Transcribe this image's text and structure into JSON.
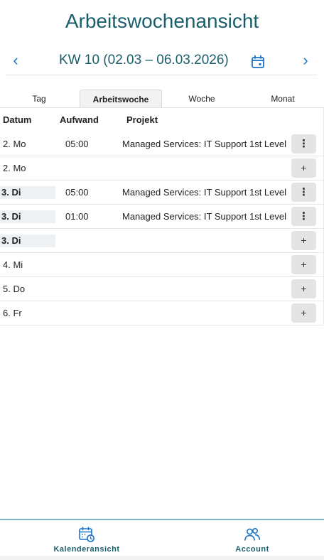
{
  "header": {
    "title": "Arbeitswochenansicht"
  },
  "week_nav": {
    "prev_symbol": "‹",
    "next_symbol": "›",
    "label": "KW 10 (02.03 – 06.03.2026)",
    "calendar_icon": "calendar-icon"
  },
  "tabs": [
    {
      "label": "Tag",
      "active": false
    },
    {
      "label": "Arbeitswoche",
      "active": true
    },
    {
      "label": "Woche",
      "active": false
    },
    {
      "label": "Monat",
      "active": false
    }
  ],
  "table": {
    "headers": {
      "date": "Datum",
      "effort": "Aufwand",
      "project": "Projekt"
    },
    "rows": [
      {
        "date": "2. Mo",
        "time": "05:00",
        "project": "Managed Services: IT Support 1st Level",
        "action": "⋮"
      },
      {
        "date": "2. Mo",
        "time": "",
        "project": "",
        "action": "+"
      },
      {
        "date": "3. Di",
        "time": "05:00",
        "project": "Managed Services: IT Support 1st Level",
        "action": "⋮"
      },
      {
        "date": "3. Di",
        "time": "01:00",
        "project": "Managed Services: IT Support 1st Level",
        "action": "⋮"
      },
      {
        "date": "3. Di",
        "time": "",
        "project": "",
        "action": "+"
      },
      {
        "date": "4. Mi",
        "time": "",
        "project": "",
        "action": "+"
      },
      {
        "date": "5. Do",
        "time": "",
        "project": "",
        "action": "+"
      },
      {
        "date": "6. Fr",
        "time": "",
        "project": "",
        "action": "+"
      }
    ]
  },
  "bottom_nav": {
    "calendar_label": "Kalenderansicht",
    "account_label": "Account"
  },
  "colors": {
    "title": "#1b5e6b",
    "accent_blue": "#1a73c8",
    "button_bg": "#e4e4e4",
    "highlight_bg": "#eef1f4"
  }
}
